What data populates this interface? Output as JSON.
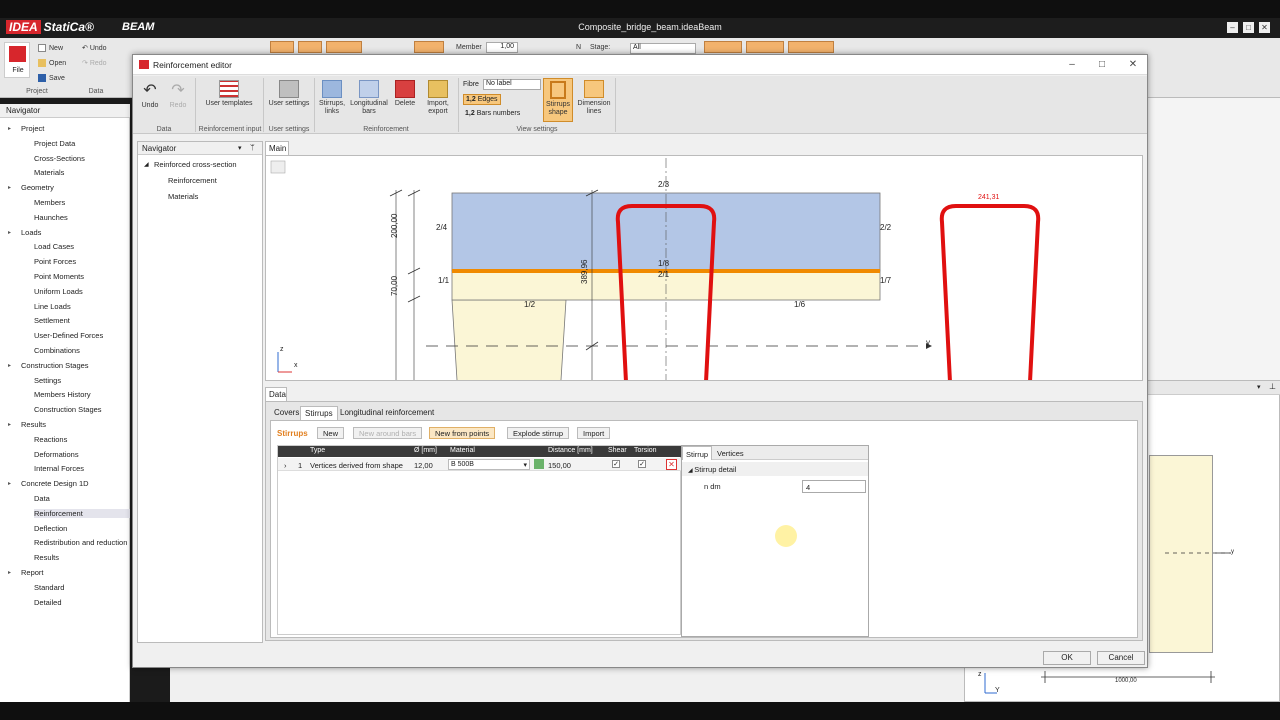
{
  "app": {
    "brand": "IDEA StatiCa",
    "brand_mark": "IDEA",
    "brand_rest": "StatiCa®",
    "product": "BEAM",
    "document_title": "Composite_bridge_beam.ideaBeam"
  },
  "main_ribbon": {
    "file_label": "File",
    "new_label": "New",
    "open_label": "Open",
    "save_label": "Save",
    "undo_label": "Undo",
    "redo_label": "Redo",
    "group_project": "Project",
    "group_data": "Data",
    "member_label": "Member",
    "member_value": "1,00",
    "stage_label": "Stage:",
    "stage_value": "All",
    "n_label": "N"
  },
  "navigator": {
    "title": "Navigator",
    "items": [
      {
        "label": "Project",
        "level": 0
      },
      {
        "label": "Project Data",
        "level": 1
      },
      {
        "label": "Cross-Sections",
        "level": 1
      },
      {
        "label": "Materials",
        "level": 1
      },
      {
        "label": "Geometry",
        "level": 0
      },
      {
        "label": "Members",
        "level": 1
      },
      {
        "label": "Haunches",
        "level": 1
      },
      {
        "label": "Loads",
        "level": 0
      },
      {
        "label": "Load Cases",
        "level": 1
      },
      {
        "label": "Point Forces",
        "level": 1
      },
      {
        "label": "Point Moments",
        "level": 1
      },
      {
        "label": "Uniform Loads",
        "level": 1
      },
      {
        "label": "Line Loads",
        "level": 1
      },
      {
        "label": "Settlement",
        "level": 1
      },
      {
        "label": "User-Defined Forces",
        "level": 1
      },
      {
        "label": "Combinations",
        "level": 1
      },
      {
        "label": "Construction Stages",
        "level": 0
      },
      {
        "label": "Settings",
        "level": 1
      },
      {
        "label": "Members History",
        "level": 1
      },
      {
        "label": "Construction Stages",
        "level": 1
      },
      {
        "label": "Results",
        "level": 0
      },
      {
        "label": "Reactions",
        "level": 1
      },
      {
        "label": "Deformations",
        "level": 1
      },
      {
        "label": "Internal Forces",
        "level": 1
      },
      {
        "label": "Concrete Design 1D",
        "level": 0
      },
      {
        "label": "Data",
        "level": 1
      },
      {
        "label": "Reinforcement",
        "level": 1
      },
      {
        "label": "Deflection",
        "level": 1
      },
      {
        "label": "Redistribution and reduction",
        "level": 1
      },
      {
        "label": "Results",
        "level": 1
      },
      {
        "label": "Report",
        "level": 0
      },
      {
        "label": "Standard",
        "level": 1
      },
      {
        "label": "Detailed",
        "level": 1
      }
    ]
  },
  "dialog": {
    "title": "Reinforcement editor",
    "ribbon": {
      "undo": "Undo",
      "redo": "Redo",
      "user_templates": "User templates",
      "user_settings": "User settings",
      "stirrups_links": "Stirrups, links",
      "longitudinal_bars": "Longitudinal bars",
      "delete": "Delete",
      "import_export": "Import, export",
      "fibre_label": "Fibre",
      "fibre_value": "No label",
      "edges_label": "Edges",
      "bars_numbers_label": "Bars numbers",
      "stirrups_shape": "Stirrups shape",
      "dimension_lines": "Dimension lines",
      "group_data": "Data",
      "group_reinf_input": "Reinforcement input",
      "group_user_settings": "User settings",
      "group_reinforcement": "Reinforcement",
      "group_view_settings": "View settings"
    },
    "navigator": {
      "title": "Navigator",
      "root": "Reinforced cross-section",
      "items": [
        "Reinforcement",
        "Materials"
      ]
    },
    "main_tab": "Main",
    "drawing": {
      "labels": [
        "2/3",
        "2/4",
        "2/2",
        "1/8",
        "2/1",
        "1/1",
        "1/7",
        "1/2",
        "1/6"
      ],
      "dim_200": "200,00",
      "dim_70": "70,00",
      "dim_389": "389,96",
      "stirrup_dim": "241,31",
      "axis_y": "y",
      "axis_z": "z",
      "axis_x": "x"
    },
    "data_tab": "Data",
    "subtabs": [
      "Covers",
      "Stirrups",
      "Longitudinal reinforcement"
    ],
    "toolbar": {
      "section_label": "Stirrups",
      "new": "New",
      "new_around_bars": "New around bars",
      "new_from_points": "New from points",
      "explode_stirrup": "Explode stirrup",
      "import": "Import"
    },
    "grid": {
      "headers": [
        "Type",
        "Ø [mm]",
        "Material",
        "Distance [mm]",
        "Shear",
        "Torsion"
      ],
      "row": {
        "index": "1",
        "type": "Vertices derived from shape",
        "diameter": "12,00",
        "material": "B 500B",
        "distance": "150,00",
        "shear": "✓",
        "torsion": "✓"
      }
    },
    "properties": {
      "tabs": [
        "Stirrup",
        "Vertices"
      ],
      "section": "Stirrup detail",
      "field_label": "n dm",
      "field_value": "4"
    },
    "ok": "OK",
    "cancel": "Cancel"
  },
  "right_panel": {
    "dimension": "1000,00",
    "axis_y": "y",
    "axis_z": "z",
    "axis_y2": "Y"
  },
  "colors": {
    "accent_red": "#d7262c",
    "selection_orange": "#f7c77d",
    "flange_blue": "#b3c6e6",
    "web_cream": "#fbf6d6",
    "steel_orange": "#f08a00",
    "stirrup_red": "#e01010"
  }
}
